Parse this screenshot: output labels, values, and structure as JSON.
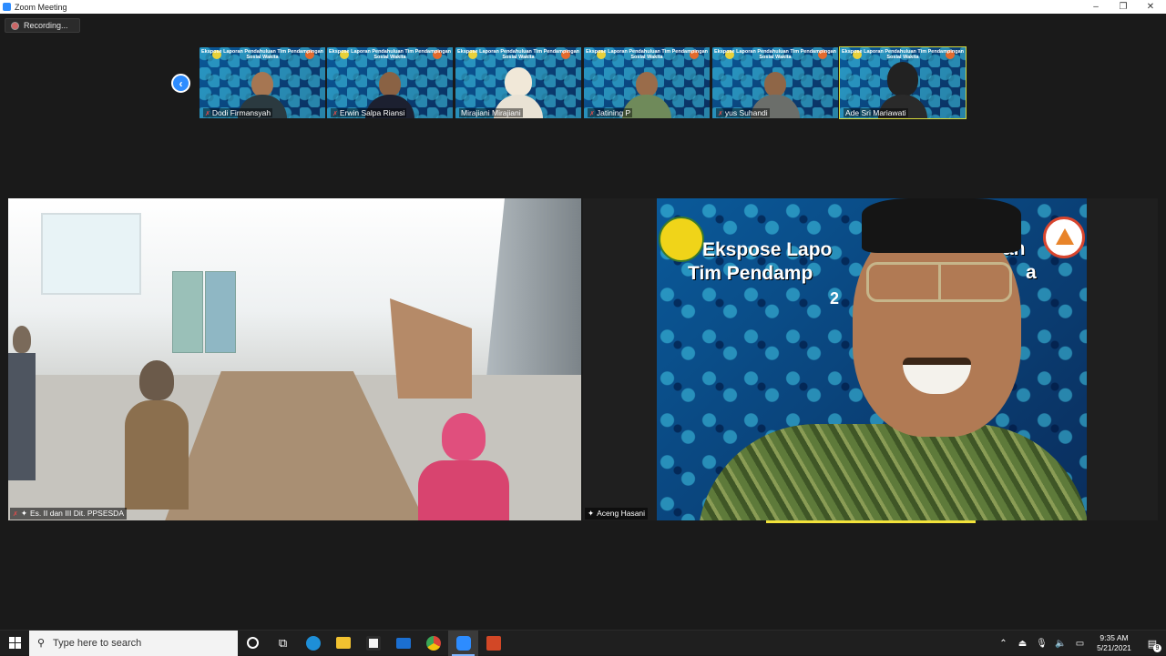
{
  "window": {
    "title": "Zoom Meeting",
    "min": "–",
    "restore": "❐",
    "close": "✕"
  },
  "recording": {
    "label": "Recording..."
  },
  "nav": {
    "prev_glyph": "‹"
  },
  "thumbnails": [
    {
      "name": "Dodi Firmansyah",
      "banner": "Ekspose Laporan Pendahuluan Tim Pendampingan Sosial Wakita",
      "muted": true
    },
    {
      "name": "Erwin Salpa Riansi",
      "banner": "Ekspose Laporan Pendahuluan Tim Pendampingan Sosial Wakita",
      "muted": true
    },
    {
      "name": "Mirajiani Mirajiani",
      "banner": "Ekspose Laporan Pendahuluan Tim Pendampingan Sosial Wakita",
      "muted": false
    },
    {
      "name": "Jatining P",
      "banner": "Ekspose Laporan Pendahuluan Tim Pendampingan Sosial Wakita",
      "muted": true
    },
    {
      "name": "yus Suhandi",
      "banner": "Ekspose Laporan Pendahuluan Tim Pendampingan Sosial Wakita",
      "muted": true
    },
    {
      "name": "Ade Sri Mariawati",
      "banner": "Ekspose Laporan Pendahuluan Tim Pendampingan Sosial Wakita",
      "muted": false
    }
  ],
  "videos": {
    "left": {
      "name": "Es. II dan III Dit. PPSESDA",
      "muted": true
    },
    "right": {
      "name": "Aceng Hasani",
      "slide_line1": "Ekspose Lapo",
      "slide_line2": "Tim Pendamp",
      "slide_suffix_1": "an",
      "slide_suffix_2": "a",
      "slide_num": "2"
    }
  },
  "taskbar": {
    "search_placeholder": "Type here to search",
    "time": "9:35 AM",
    "date": "5/21/2021",
    "notification_count": "9",
    "icons": [
      "cortana-icon",
      "task-view-icon",
      "edge-icon",
      "file-explorer-icon",
      "store-icon",
      "mail-icon",
      "chrome-icon",
      "zoom-icon",
      "powerpoint-icon"
    ],
    "colors": {
      "edge": "#1e8fd8",
      "explorer": "#f2c230",
      "store": "#2b2b2b",
      "mail": "#1b6fd1",
      "chrome": "#3aa757",
      "zoom": "#2d8cff",
      "powerpoint": "#d24726"
    }
  }
}
